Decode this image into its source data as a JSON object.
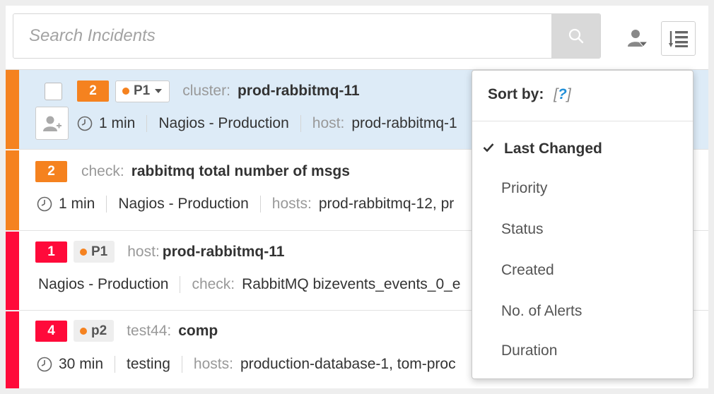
{
  "colors": {
    "orange": "#f5821f",
    "red": "#ff0a3a",
    "selected_bg": "#ddebf7",
    "link_blue": "#1f8ed8"
  },
  "search": {
    "placeholder": "Search Incidents"
  },
  "icons": {
    "search": "search-icon",
    "assign_filter": "user-filter-icon",
    "sort": "sort-list-icon",
    "assign": "add-user-icon",
    "clock": "clock-icon",
    "check": "check-icon"
  },
  "incidents": [
    {
      "stripe": "orange",
      "count": "2",
      "priority": "P1",
      "k1": "cluster:",
      "v1": "prod-rabbitmq-11",
      "age": "1 min",
      "source": "Nagios - Production",
      "k2": "host:",
      "v2": "prod-rabbitmq-1"
    },
    {
      "stripe": "orange",
      "count": "2",
      "k1": "check:",
      "v1": "rabbitmq total number of msgs",
      "age": "1 min",
      "source": "Nagios - Production",
      "k2": "hosts:",
      "v2": "prod-rabbitmq-12,  pr"
    },
    {
      "stripe": "red",
      "count": "1",
      "priority": "P1",
      "k1": "host:",
      "v1": "prod-rabbitmq-11",
      "source": "Nagios - Production",
      "k2": "check:",
      "v2": "RabbitMQ bizevents_events_0_e"
    },
    {
      "stripe": "red",
      "count": "4",
      "priority": "p2",
      "k1": "test44:",
      "v1": "comp",
      "age": "30 min",
      "source": "testing",
      "k2": "hosts:",
      "v2": "production-database-1,  tom-proc"
    }
  ],
  "sort_menu": {
    "title": "Sort by:",
    "help_open": "[",
    "help_q": "?",
    "help_close": "]",
    "items": [
      "Last Changed",
      "Priority",
      "Status",
      "Created",
      "No. of Alerts",
      "Duration"
    ],
    "active": "Last Changed"
  }
}
